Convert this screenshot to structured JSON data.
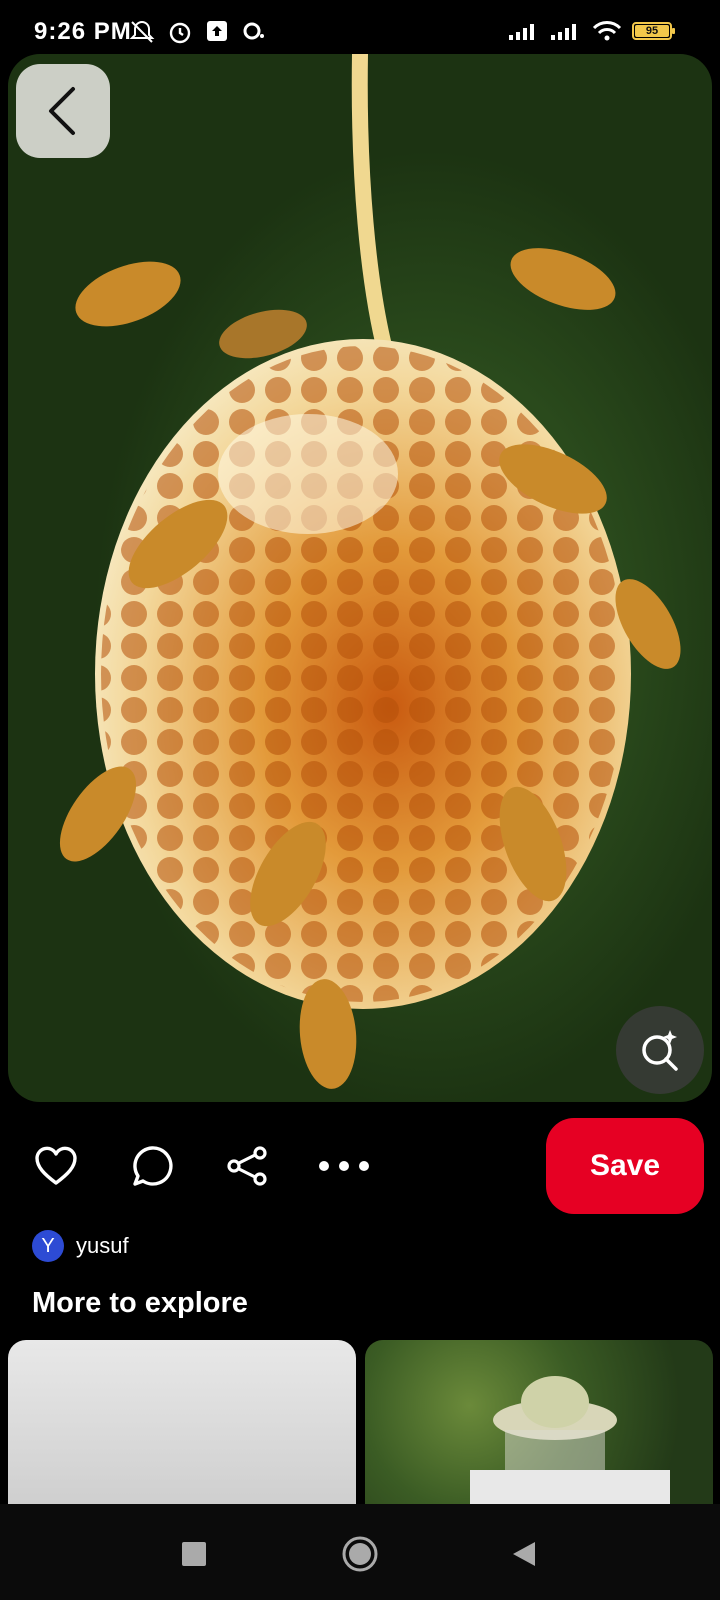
{
  "status_bar": {
    "time": "9:26 PM",
    "battery_level": "95"
  },
  "pin": {
    "save_label": "Save",
    "author_initial": "Y",
    "author_name": "yusuf"
  },
  "explore": {
    "title": "More to explore"
  },
  "colors": {
    "save": "#e60023",
    "avatar": "#2d4bd4",
    "battery": "#f2c84b"
  },
  "icons": [
    "back-icon",
    "visual-search-icon",
    "heart-icon",
    "comment-icon",
    "share-icon",
    "more-icon",
    "nav-recents-icon",
    "nav-home-icon",
    "nav-back-icon"
  ]
}
